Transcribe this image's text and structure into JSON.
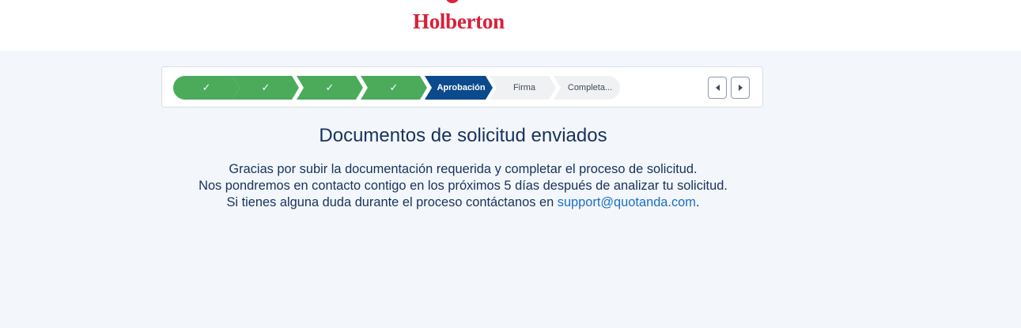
{
  "header": {
    "brand": "Holberton"
  },
  "steps": [
    {
      "label": "",
      "status": "complete",
      "icon": "check-icon"
    },
    {
      "label": "",
      "status": "complete",
      "icon": "check-icon"
    },
    {
      "label": "",
      "status": "complete",
      "icon": "check-icon"
    },
    {
      "label": "",
      "status": "complete",
      "icon": "check-icon"
    },
    {
      "label": "Aprobación",
      "status": "current"
    },
    {
      "label": "Firma",
      "status": "incomplete"
    },
    {
      "label": "Completa...",
      "status": "incomplete"
    }
  ],
  "nav": {
    "prev_icon": "chevron-left-icon",
    "next_icon": "chevron-right-icon"
  },
  "main": {
    "title": "Documentos de solicitud enviados",
    "line1": "Gracias por subir la documentación requerida y completar el proceso de solicitud.",
    "line2": "Nos pondremos en contacto contigo en los próximos 5 días después de analizar tu solicitud.",
    "line3_prefix": "Si tienes alguna duda durante el proceso contáctanos en ",
    "email": "support@quotanda.com",
    "line3_suffix": "."
  },
  "colors": {
    "complete": "#4bab5b",
    "current": "#0b4a8c",
    "incomplete": "#f0f1f3",
    "brand": "#d8203a",
    "link": "#1a6fc7"
  }
}
